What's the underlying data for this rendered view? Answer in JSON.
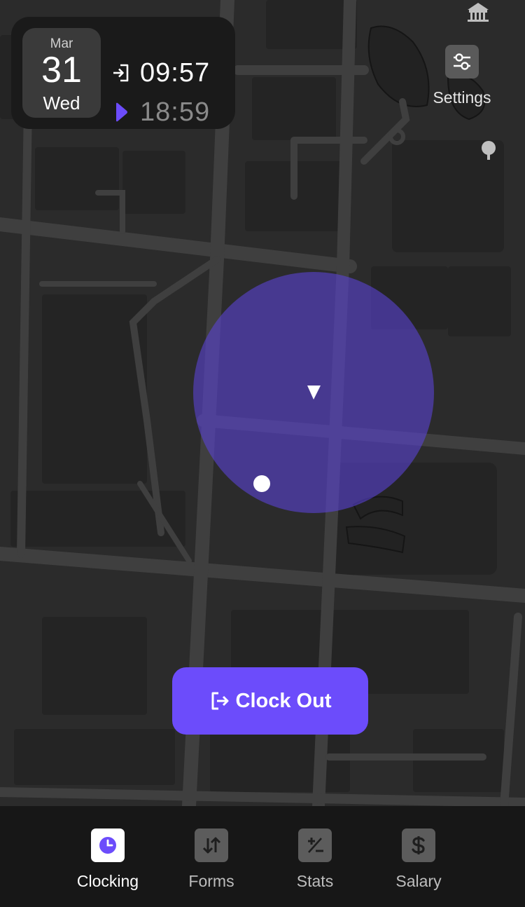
{
  "date": {
    "month": "Mar",
    "day": "31",
    "weekday": "Wed"
  },
  "times": {
    "clock_in": "09:57",
    "clock_out": "18:59"
  },
  "settings": {
    "label": "Settings"
  },
  "action": {
    "label": "Clock Out"
  },
  "nav": {
    "items": [
      {
        "label": "Clocking",
        "icon": "clock-icon",
        "active": true
      },
      {
        "label": "Forms",
        "icon": "arrows-updown-icon",
        "active": false
      },
      {
        "label": "Stats",
        "icon": "plus-minus-icon",
        "active": false
      },
      {
        "label": "Salary",
        "icon": "dollar-icon",
        "active": false
      }
    ]
  },
  "colors": {
    "accent": "#6c4cfb",
    "map_background": "#2b2b2b",
    "geofence": "#5c44d9",
    "nav_background": "#171717"
  }
}
